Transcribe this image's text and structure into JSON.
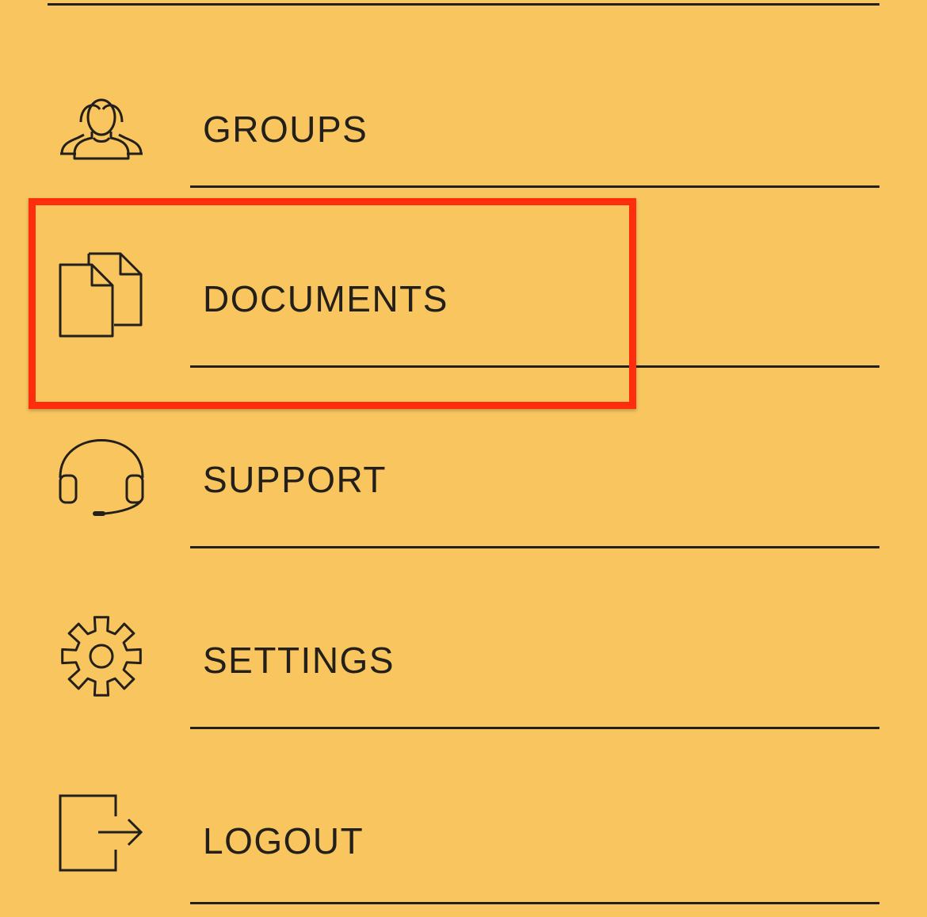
{
  "menu": {
    "items": [
      {
        "label": "GROUPS",
        "icon": "users-group-icon"
      },
      {
        "label": "DOCUMENTS",
        "icon": "documents-icon"
      },
      {
        "label": "SUPPORT",
        "icon": "headset-icon"
      },
      {
        "label": "SETTINGS",
        "icon": "gear-icon"
      },
      {
        "label": "LOGOUT",
        "icon": "logout-icon"
      }
    ],
    "highlighted_item": "DOCUMENTS"
  },
  "colors": {
    "background": "#F8C55F",
    "text": "#231F1A",
    "highlight": "#FE2D0C"
  }
}
